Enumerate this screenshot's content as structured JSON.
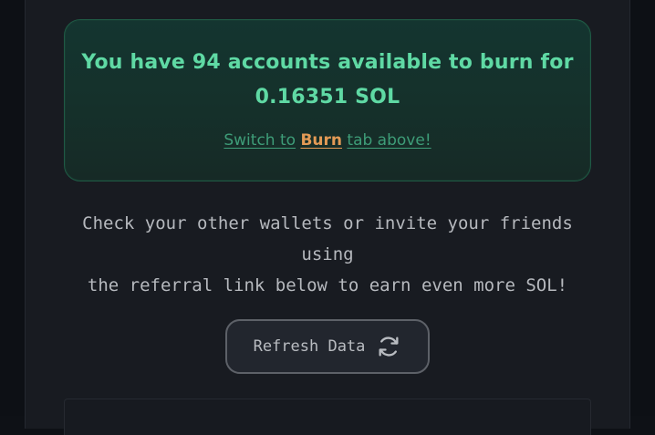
{
  "summary": {
    "prefix": "You have",
    "account_count": "94",
    "middle": "accounts available to burn for",
    "amount": "0.16351 SOL",
    "switch_prefix": "Switch to",
    "switch_link": "Burn",
    "switch_suffix": "tab above!"
  },
  "info": {
    "line1": "Check your other wallets or invite your friends using",
    "line2": "the referral link below to earn even more SOL!"
  },
  "refresh": {
    "label": "Refresh Data",
    "icon": "refresh-icon"
  },
  "colors": {
    "accent_green": "#5fd9a4",
    "link_green": "#3e9d78",
    "burn_orange": "#e39a55",
    "panel_bg": "#181b21"
  }
}
